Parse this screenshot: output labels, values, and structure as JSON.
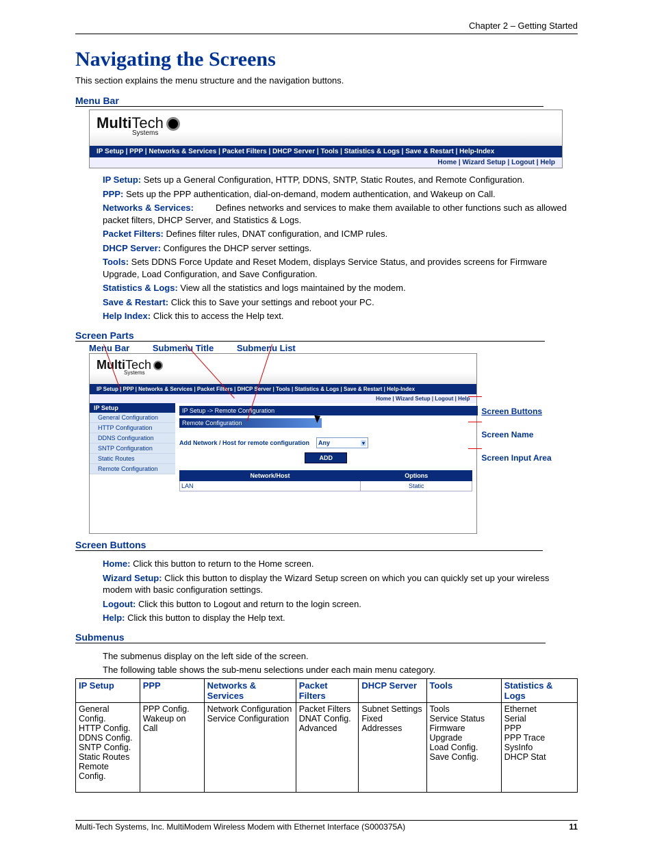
{
  "chapter_header": "Chapter 2 – Getting Started",
  "page_title": "Navigating the Screens",
  "intro": "This section explains the menu structure and the navigation buttons.",
  "menu_bar_heading": "Menu Bar",
  "logo_bold": "Multi",
  "logo_light": "Tech",
  "logo_sub": "Systems",
  "menubar_items": "IP Setup  |   PPP  |   Networks & Services  |   Packet Filters  |   DHCP Server  |   Tools  |   Statistics & Logs  |   Save & Restart  |   Help-Index",
  "subbar_items": "Home  |  Wizard Setup  |  Logout  |  Help",
  "descs": [
    {
      "term": "IP Setup:",
      "text": " Sets up a General Configuration, HTTP, DDNS, SNTP, Static Routes, and Remote Configuration."
    },
    {
      "term": "PPP:",
      "text": " Sets up the PPP authentication, dial-on-demand, modem authentication, and Wakeup on Call."
    },
    {
      "term": "Networks & Services:",
      "text": "Defines networks and services to make them available to other functions such as allowed packet filters, DHCP Server, and Statistics & Logs.",
      "wide": true
    },
    {
      "term": "Packet Filters:",
      "text": " Defines filter rules, DNAT configuration, and ICMP rules."
    },
    {
      "term": "DHCP Server:",
      "text": " Configures the DHCP server settings."
    },
    {
      "term": "Tools:",
      "text": " Sets DDNS Force Update and Reset Modem, displays Service Status, and provides screens for Firmware Upgrade, Load Configuration, and Save Configuration.",
      "cont": true
    },
    {
      "term": "Statistics & Logs:",
      "text": " View all the statistics and logs maintained by the modem."
    },
    {
      "term": "Save & Restart:",
      "text": " Click this to Save your settings and reboot your PC."
    },
    {
      "term": "Help Index:",
      "text": " Click this to access the Help text."
    }
  ],
  "screen_parts_heading": "Screen Parts",
  "parts_labels": {
    "a": "Menu Bar",
    "b": "Submenu Title",
    "c": "Submenu List"
  },
  "right_callouts": {
    "a": "Screen Buttons",
    "b": "Screen Name",
    "c": "Screen Input Area"
  },
  "ui2": {
    "menubar_items": "IP Setup  |  PPP  |  Networks & Services  |  Packet Filters  |  DHCP Server  |  Tools  |  Statistics & Logs  |  Save & Restart  |  Help-Index",
    "subbar_items": "Home  |  Wizard Setup  |  Logout  |  Help",
    "side_h": "IP Setup",
    "side_items": [
      "General Configuration",
      "HTTP Configuration",
      "DDNS Configuration",
      "SNTP Configuration",
      "Static Routes",
      "Remote Configuration"
    ],
    "crumb": "IP Setup  ->  Remote Configuration",
    "screen_title": "Remote Configuration",
    "form_label": "Add Network / Host for remote configuration",
    "select_value": "Any",
    "add": "ADD",
    "th1": "Network/Host",
    "th2": "Options",
    "td1": "LAN",
    "td2": "Static"
  },
  "screen_buttons_heading": "Screen Buttons",
  "sb": [
    {
      "term": "Home:",
      "text": " Click this button to return to the Home screen."
    },
    {
      "term": "Wizard Setup:",
      "text": " Click this button to display the Wizard Setup screen on which you can quickly set up your wireless modem with basic configuration settings.",
      "cont": true
    },
    {
      "term": "Logout:",
      "text": " Click this button to Logout and return to the login screen."
    },
    {
      "term": "Help:",
      "text": " Click this button to display the Help text."
    }
  ],
  "submenus_heading": "Submenus",
  "submenus_p1": "The submenus display on the left side of the screen.",
  "submenus_p2": "The following table shows the sub-menu selections under each main menu category.",
  "subtable": {
    "headers": [
      "IP Setup",
      "PPP",
      "Networks & Services",
      "Packet Filters",
      "DHCP Server",
      "Tools",
      "Statistics & Logs"
    ],
    "rows": [
      [
        "General Config.",
        "PPP Config.",
        "Network Configuration",
        "Packet Filters",
        "Subnet Settings",
        "Tools",
        "Ethernet"
      ],
      [
        "HTTP Config.",
        "Wakeup on Call",
        "Service Configuration",
        "DNAT Config.",
        "Fixed Addresses",
        "Service Status",
        "Serial"
      ],
      [
        "DDNS Config.",
        "",
        "",
        "Advanced",
        "",
        "Firmware Upgrade",
        "PPP"
      ],
      [
        "SNTP Config.",
        "",
        "",
        "",
        "",
        "Load Config.",
        "PPP Trace"
      ],
      [
        "Static Routes",
        "",
        "",
        "",
        "",
        "Save Config.",
        "SysInfo"
      ],
      [
        "Remote Config.",
        "",
        "",
        "",
        "",
        "",
        "DHCP Stat"
      ]
    ]
  },
  "footer_left": "Multi-Tech Systems, Inc. MultiModem Wireless Modem with Ethernet Interface (S000375A)",
  "footer_right": "11"
}
